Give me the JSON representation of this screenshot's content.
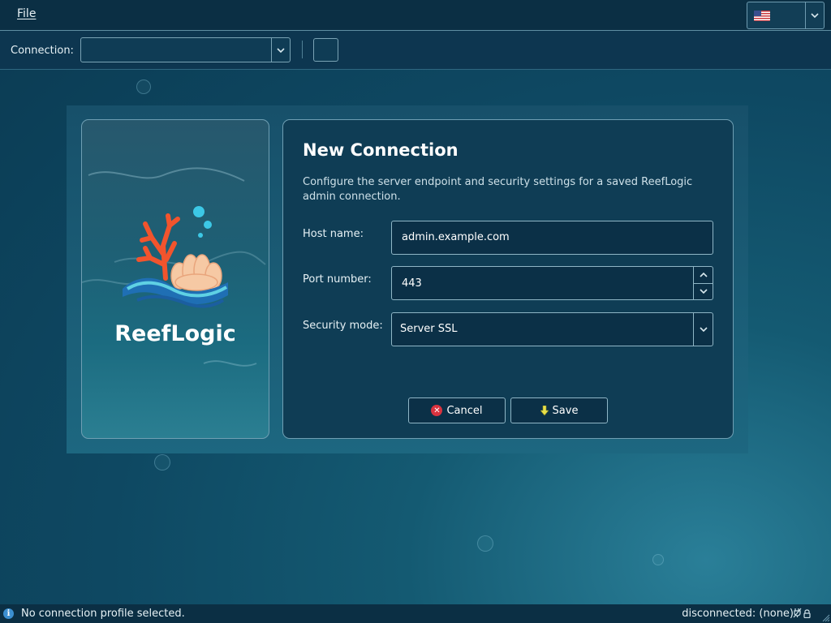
{
  "menubar": {
    "file_label": "File",
    "language_icon": "us-flag-icon"
  },
  "toolbar": {
    "connection_label": "Connection:",
    "connection_value": ""
  },
  "brand": {
    "name": "ReefLogic"
  },
  "dialog": {
    "title": "New Connection",
    "description": "Configure the server endpoint and security settings for a saved ReefLogic admin connection.",
    "host_label": "Host name:",
    "host_value": "admin.example.com",
    "port_label": "Port number:",
    "port_value": "443",
    "security_label": "Security mode:",
    "security_value": "Server SSL",
    "cancel_label": "Cancel",
    "save_label": "Save"
  },
  "status": {
    "message": "No connection profile selected.",
    "connection_state": "disconnected: (none)"
  },
  "colors": {
    "cancel": "#d9333f",
    "save": "#e8e04a",
    "info": "#3b8fd1"
  }
}
